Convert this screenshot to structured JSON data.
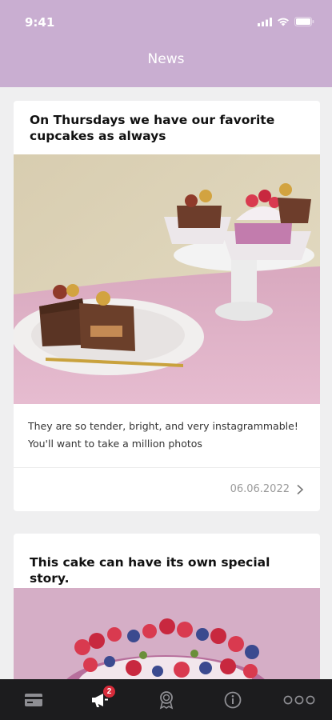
{
  "status_bar": {
    "time": "9:41"
  },
  "header": {
    "title": "News"
  },
  "posts": [
    {
      "title": "On Thursdays we have our favorite cupcakes as always",
      "text": "They are so tender, bright, and very instagrammable! You'll want to take a million photos",
      "date": "06.06.2022"
    },
    {
      "title": "This cake can have its own special story."
    }
  ],
  "tabbar": {
    "items": [
      {
        "icon": "card-icon"
      },
      {
        "icon": "megaphone-icon",
        "badge": "2"
      },
      {
        "icon": "award-icon"
      },
      {
        "icon": "info-icon"
      },
      {
        "icon": "more-icon"
      }
    ]
  },
  "colors": {
    "header": "#c9aed1",
    "tabbar": "#1c1c1e",
    "badge": "#d62b3a",
    "background": "#efeff0"
  }
}
